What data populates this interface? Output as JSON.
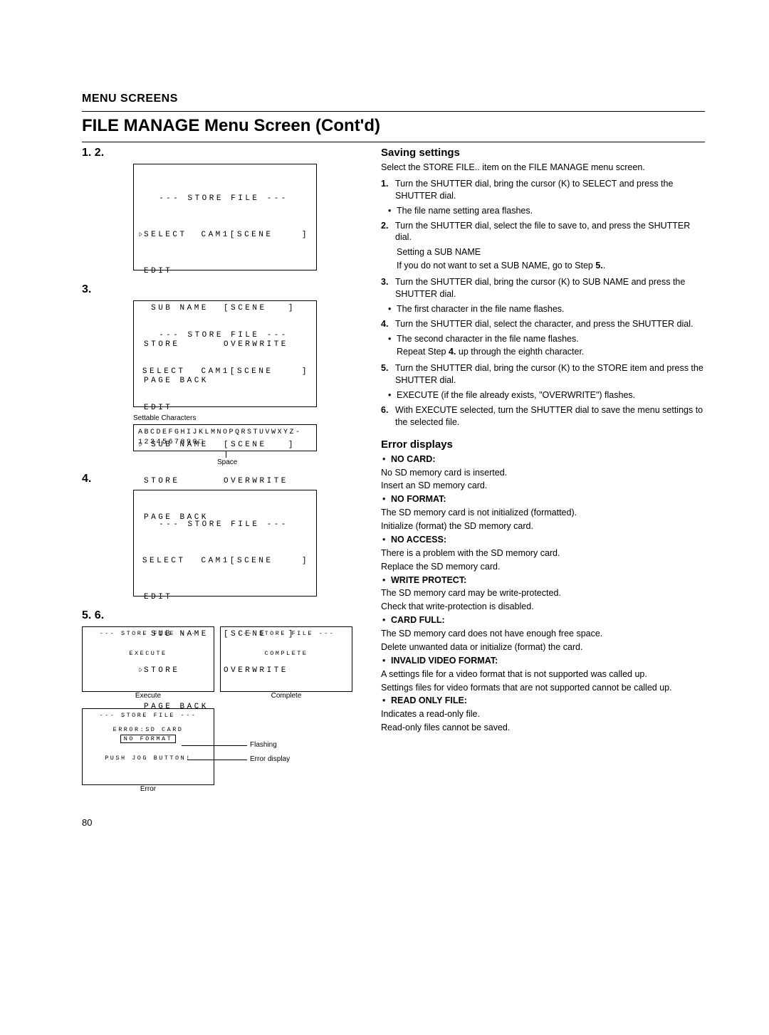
{
  "header": {
    "kicker": "MENU SCREENS",
    "title": "FILE MANAGE Menu Screen (Cont'd)"
  },
  "left": {
    "step12": "1. 2.",
    "step3": "3.",
    "step4": "4.",
    "step56": "5. 6.",
    "settable_label": "Settable Characters",
    "charset_line1": "ABCDEFGHIJKLMNOPQRSTUVWXYZ-",
    "charset_line2": "1234567890□",
    "space_label": "Space",
    "execute_label": "Execute",
    "complete_label": "Complete",
    "error_label": "Error",
    "flashing_label": "Flashing",
    "errordisplay_label": "Error display"
  },
  "menu": {
    "title": "--- STORE FILE ---",
    "select": "SELECT",
    "edit": "EDIT",
    "subname": " SUB NAME",
    "store": "STORE",
    "pageback": "PAGE BACK",
    "val_select": "CAM1[SCENE    ]",
    "val_subname": "[SCENE   ]",
    "val_store": "OVERWRITE",
    "cursor": "▷"
  },
  "mini": {
    "title": "--- STORE FILE ---",
    "execute": "EXECUTE",
    "complete": "COMPLETE",
    "err_line": "ERROR:SD CARD",
    "err_box": "NO FORMAT",
    "push": "PUSH JOG BUTTON!"
  },
  "right": {
    "saving_h": "Saving settings",
    "saving_intro": "Select the STORE FILE.. item on the FILE MANAGE menu screen.",
    "steps": [
      {
        "n": "1.",
        "b": "Turn the SHUTTER dial, bring the cursor (K) to SELECT and press the SHUTTER dial.",
        "s": "The file name setting area flashes."
      },
      {
        "n": "2.",
        "b": "Turn the SHUTTER dial, select the file to save to, and press the SHUTTER dial.",
        "extra1": "Setting a SUB NAME",
        "extra2": "If you do not want to set a SUB NAME, go to Step 5.."
      },
      {
        "n": "3.",
        "b": "Turn the SHUTTER dial, bring the cursor (K) to SUB NAME and press the SHUTTER dial.",
        "s": "The first character in the file name flashes."
      },
      {
        "n": "4.",
        "b": "Turn the SHUTTER dial, select the character, and press the SHUTTER dial.",
        "s": "The second character in the file name flashes.",
        "rep": "Repeat Step 4. up through the eighth character."
      },
      {
        "n": "5.",
        "b": "Turn the SHUTTER dial, bring the cursor (K) to the STORE item and press the SHUTTER dial.",
        "s": "EXECUTE (if the file already exists, \"OVERWRITE\") flashes."
      },
      {
        "n": "6.",
        "b": "With EXECUTE selected, turn the SHUTTER dial to save the menu settings to the selected file."
      }
    ],
    "err_h": "Error displays",
    "errors": [
      {
        "t": "NO CARD:",
        "l1": "No SD memory card is inserted.",
        "l2": "Insert an SD memory card."
      },
      {
        "t": "NO FORMAT:",
        "l1": "The SD memory card is not initialized (formatted).",
        "l2": "Initialize (format) the SD memory card."
      },
      {
        "t": "NO ACCESS:",
        "l1": "There is a problem with the SD memory card.",
        "l2": "Replace the SD memory card."
      },
      {
        "t": "WRITE PROTECT:",
        "l1": "The SD memory card may be write-protected.",
        "l2": "Check that write-protection is disabled."
      },
      {
        "t": "CARD FULL:",
        "l1": "The SD memory card does not have enough free space.",
        "l2": "Delete unwanted data or initialize (format) the card."
      },
      {
        "t": "INVALID VIDEO FORMAT:",
        "l1": "A settings file for a video format that is not supported was called up.",
        "l2": "Settings files for video formats that are not supported cannot be called up."
      },
      {
        "t": "READ ONLY FILE:",
        "l1": "Indicates a read-only file.",
        "l2": "Read-only files cannot be saved."
      }
    ]
  },
  "page_no": "80"
}
